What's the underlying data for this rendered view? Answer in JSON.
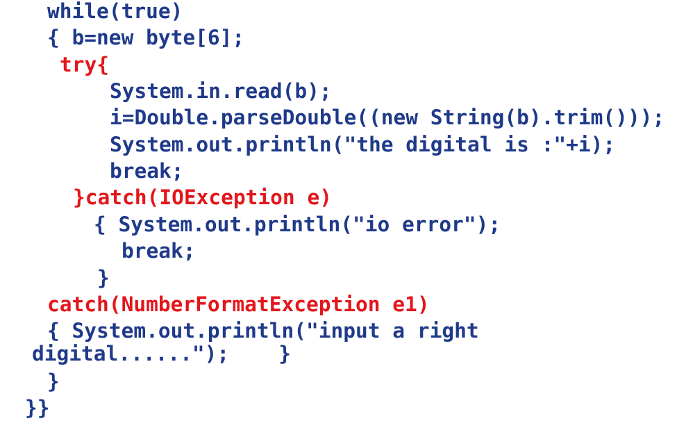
{
  "colors": {
    "code": "#1f3a8a",
    "highlight": "#e3161b"
  },
  "lines": [
    {
      "segments": [
        {
          "text": "while(true)",
          "style": "plain"
        }
      ]
    },
    {
      "segments": [
        {
          "text": "{ b=new byte[6];",
          "style": "plain"
        }
      ]
    },
    {
      "segments": [
        {
          "text": "try{",
          "style": "keyword"
        }
      ]
    },
    {
      "segments": [
        {
          "text": "System.in.read(b);",
          "style": "plain"
        }
      ]
    },
    {
      "segments": [
        {
          "text": "i=Double.parseDouble((new String(b).trim()));",
          "style": "plain"
        }
      ]
    },
    {
      "segments": [
        {
          "text": "System.out.println(\"the digital is :\"+i);",
          "style": "plain"
        }
      ]
    },
    {
      "segments": [
        {
          "text": "break;",
          "style": "plain"
        }
      ]
    },
    {
      "segments": [
        {
          "text": "}catch(IOException e)",
          "style": "keyword"
        }
      ]
    },
    {
      "segments": [
        {
          "text": "{ System.out.println(\"io error\");",
          "style": "plain"
        }
      ]
    },
    {
      "segments": [
        {
          "text": "break;",
          "style": "plain"
        }
      ]
    },
    {
      "segments": [
        {
          "text": "}",
          "style": "plain"
        }
      ]
    },
    {
      "segments": [
        {
          "text": "catch(NumberFormatException e1)",
          "style": "keyword"
        }
      ]
    },
    {
      "segments": [
        {
          "text": "{ System.out.println(\"input a right",
          "style": "plain"
        }
      ]
    },
    {
      "segments": [
        {
          "text": "digital......\");    }",
          "style": "plain"
        }
      ]
    },
    {
      "segments": [
        {
          "text": "}",
          "style": "plain"
        }
      ]
    },
    {
      "segments": [
        {
          "text": "}}",
          "style": "plain"
        }
      ]
    }
  ]
}
